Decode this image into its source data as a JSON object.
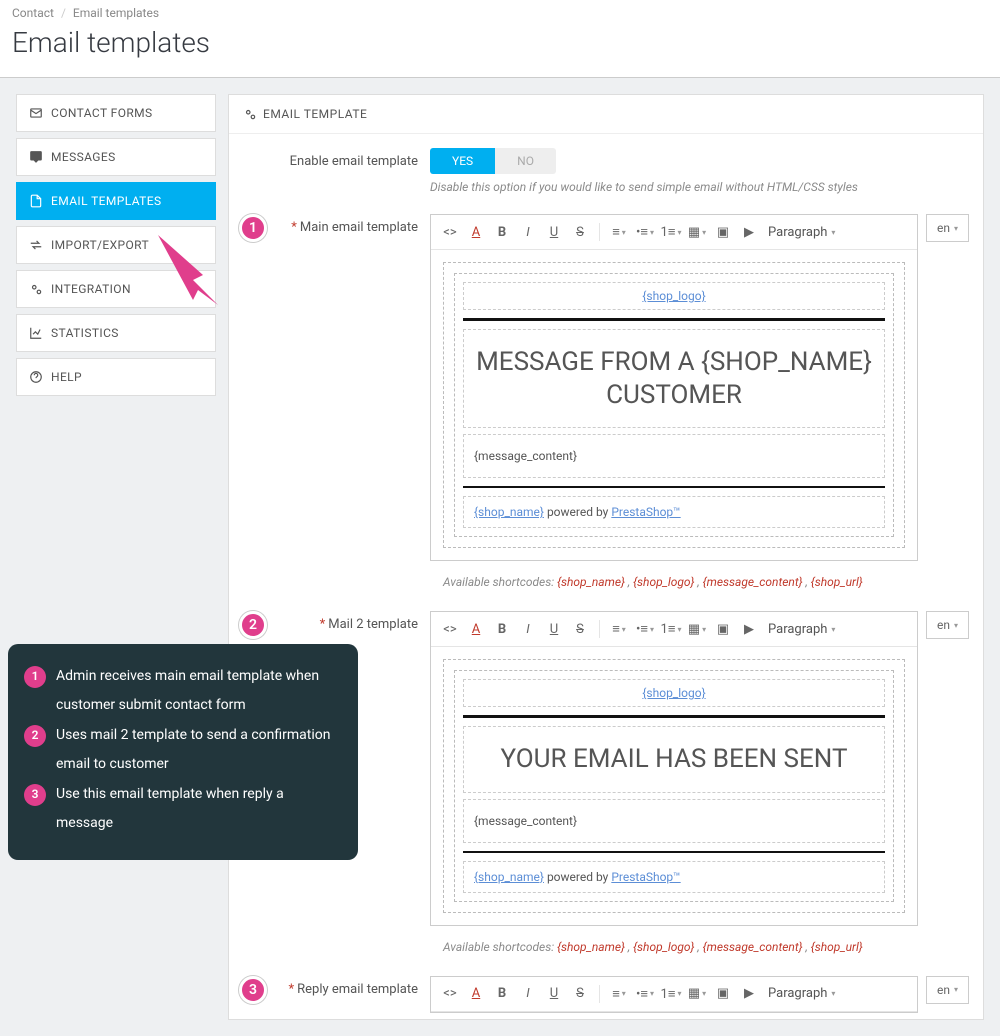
{
  "breadcrumb": {
    "a": "Contact",
    "b": "Email templates"
  },
  "page_title": "Email templates",
  "sidebar": {
    "items": [
      {
        "label": "CONTACT FORMS"
      },
      {
        "label": "MESSAGES"
      },
      {
        "label": "EMAIL TEMPLATES"
      },
      {
        "label": "IMPORT/EXPORT"
      },
      {
        "label": "INTEGRATION"
      },
      {
        "label": "STATISTICS"
      },
      {
        "label": "HELP"
      }
    ]
  },
  "panel": {
    "title": "EMAIL TEMPLATE"
  },
  "enable": {
    "label": "Enable email template",
    "yes": "YES",
    "no": "NO",
    "hint": "Disable this option if you would like to send simple email without HTML/CSS styles"
  },
  "lang": "en",
  "toolbar": {
    "paragraph": "Paragraph"
  },
  "templates": [
    {
      "badge": "1",
      "label": "Main email template",
      "logo": "{shop_logo}",
      "heading": "MESSAGE FROM A {SHOP_NAME} CUSTOMER",
      "message": "{message_content}",
      "foot_a": "{shop_name}",
      "foot_mid": " powered by ",
      "foot_b": "PrestaShop™"
    },
    {
      "badge": "2",
      "label": "Mail 2 template",
      "logo": "{shop_logo}",
      "heading": "YOUR EMAIL HAS BEEN SENT",
      "message": "{message_content}",
      "foot_a": "{shop_name}",
      "foot_mid": " powered by ",
      "foot_b": "PrestaShop™"
    },
    {
      "badge": "3",
      "label": "Reply email template"
    }
  ],
  "shortcodes": {
    "prefix": "Available shortcodes: ",
    "a": "{shop_name}",
    "b": "{shop_logo}",
    "c": "{message_content}",
    "d": "{shop_url}",
    "sep": " , "
  },
  "legend": {
    "i1": "Admin receives main email template when customer submit contact form",
    "i2": "Uses mail 2 template to send a confirmation email to customer",
    "i3": "Use this email template when reply a message"
  }
}
